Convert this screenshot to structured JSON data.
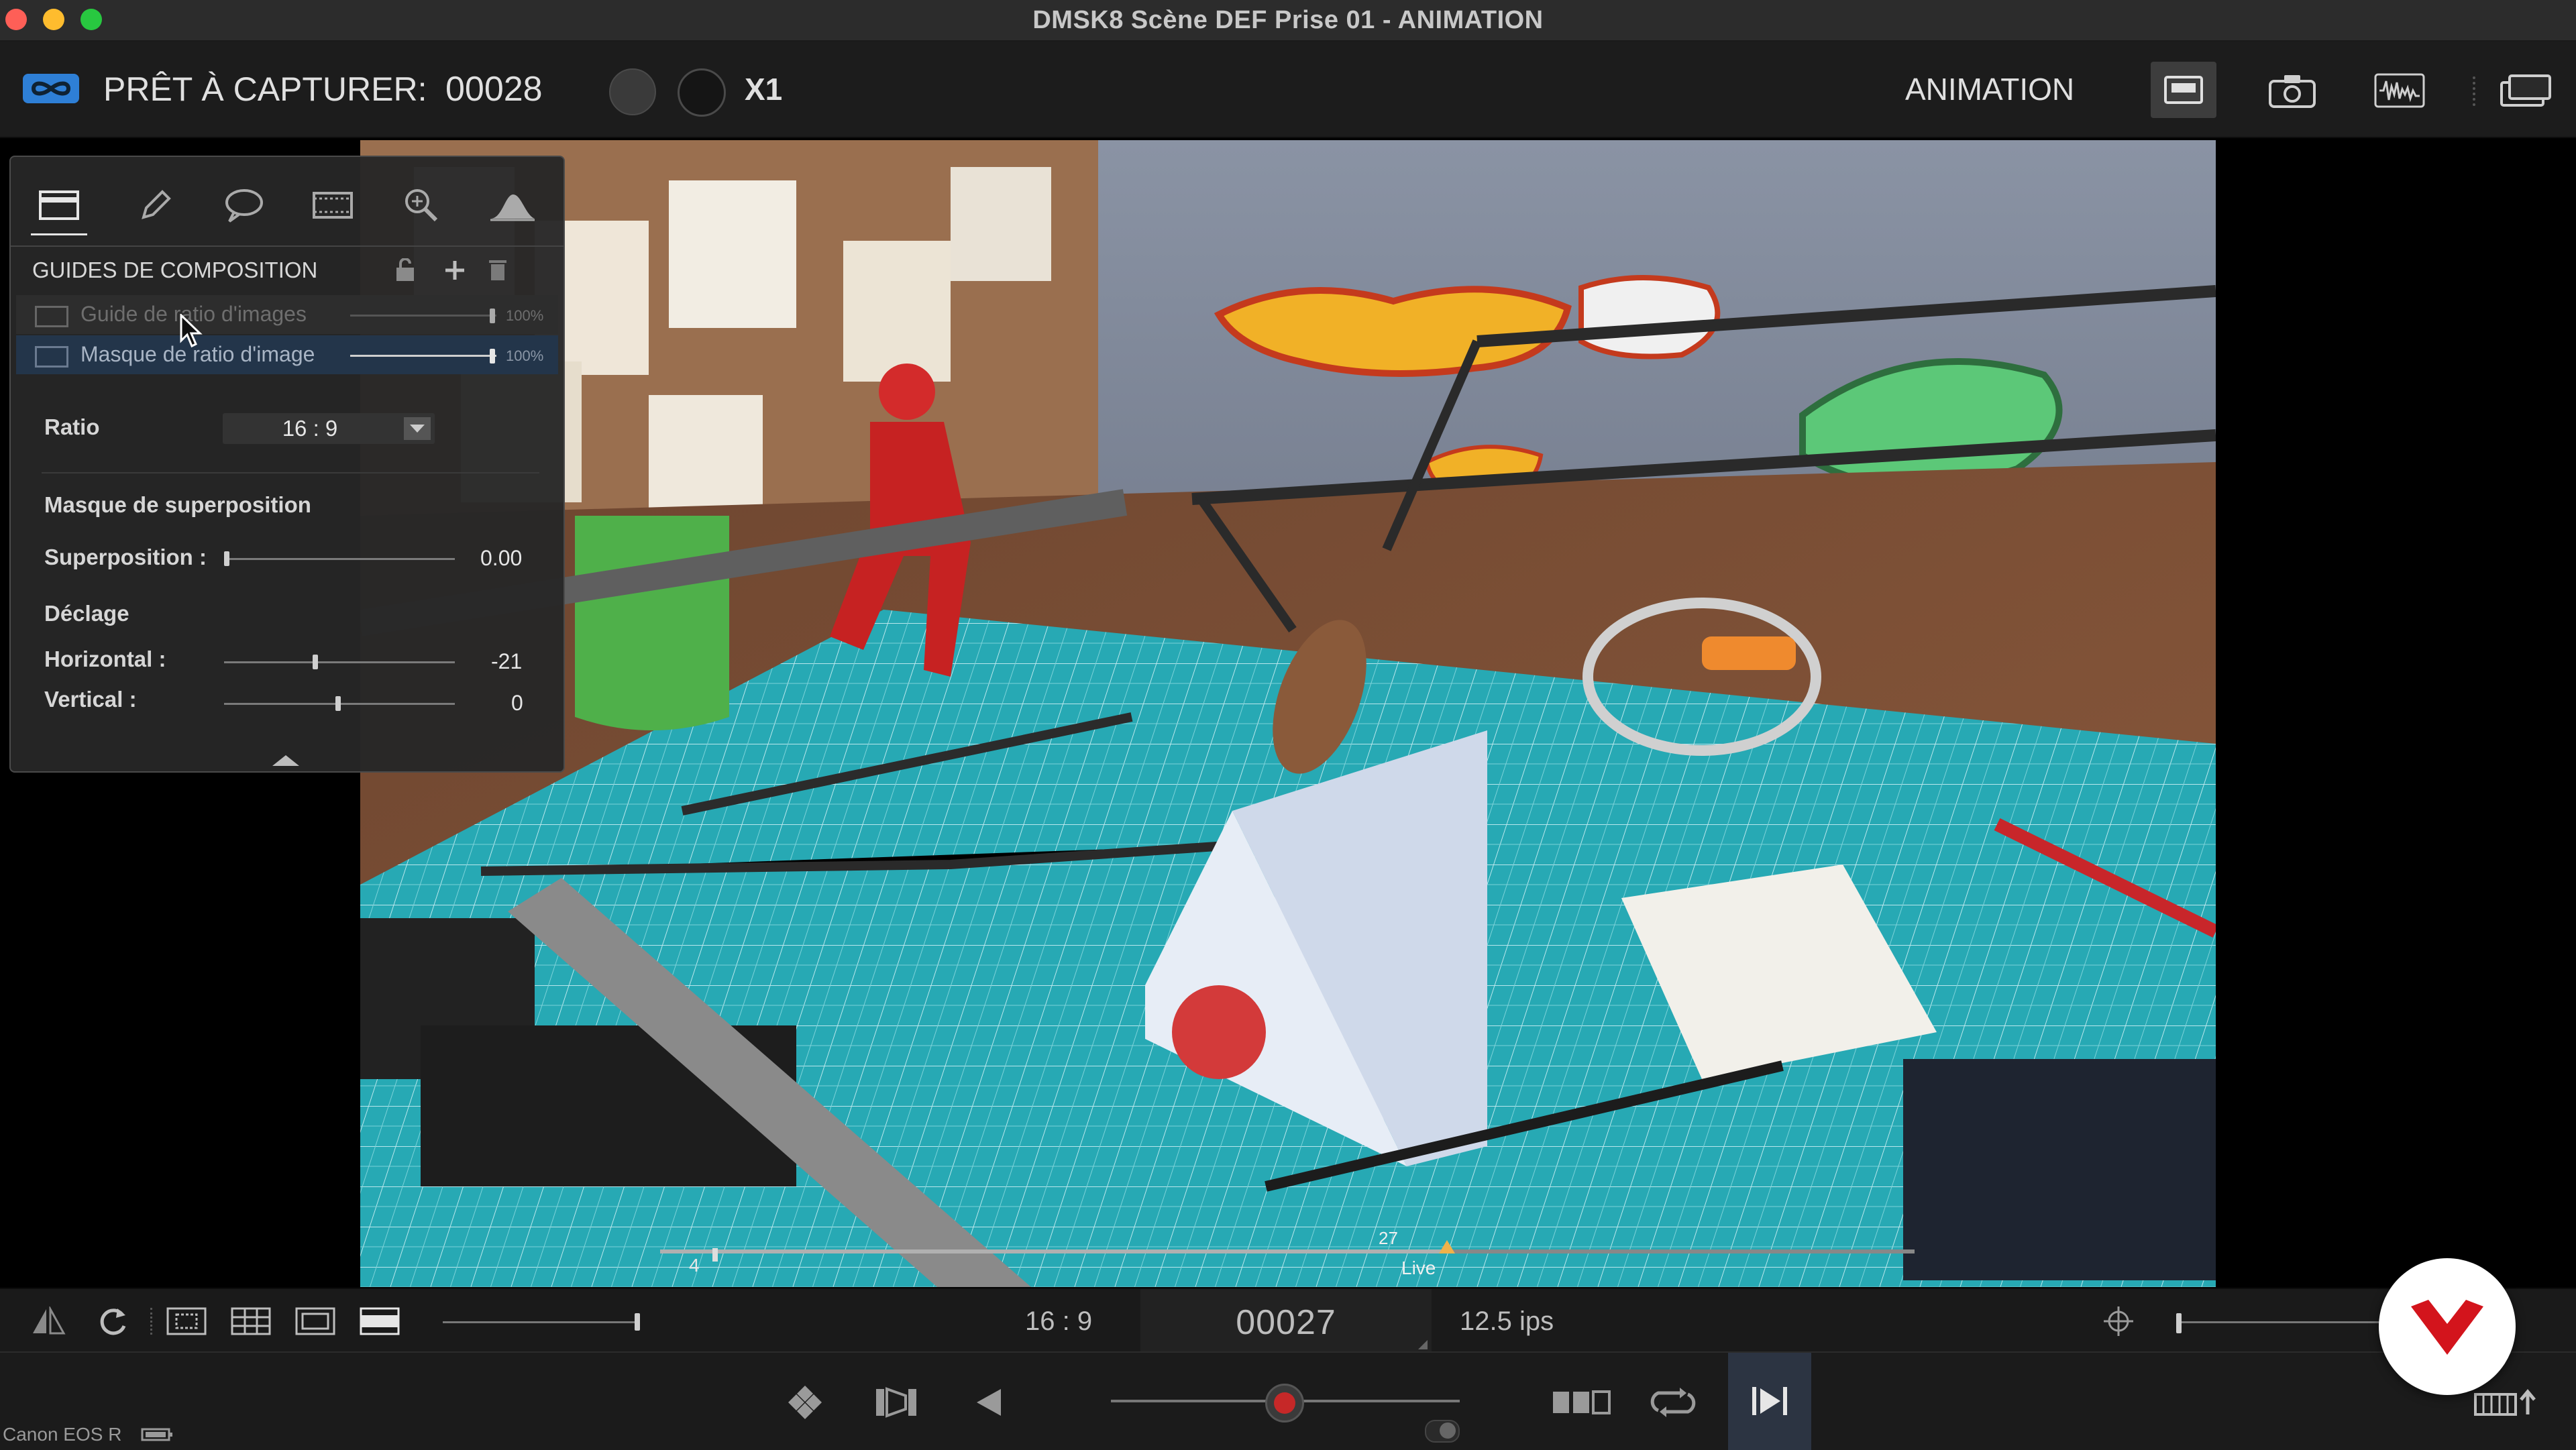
{
  "window": {
    "title": "DMSK8  Scène DEF  Prise 01 - ANIMATION"
  },
  "topbar": {
    "status_label": "PRÊT À CAPTURER:",
    "frame_counter": "00028",
    "multiplier": "X1",
    "mode_label": "ANIMATION"
  },
  "panel": {
    "section_title": "GUIDES DE COMPOSITION",
    "layers": [
      {
        "label": "Guide de ratio d'images",
        "opacity": "100%",
        "value": 1.0
      },
      {
        "label": "Masque de ratio d'image",
        "opacity": "100%",
        "value": 1.0
      }
    ],
    "ratio_label": "Ratio",
    "ratio_value": "16 : 9",
    "overlay_mask_title": "Masque de superposition",
    "overlay_label": "Superposition :",
    "overlay_value": "0.00",
    "offset_title": "Déclage",
    "horizontal_label": "Horizontal :",
    "horizontal_value": "-21",
    "vertical_label": "Vertical :",
    "vertical_value": "0"
  },
  "timeline": {
    "start_marker": "4",
    "current_marker": "27",
    "live_label": "Live"
  },
  "bottombar": {
    "aspect_label": "16 : 9",
    "current_frame": "00027",
    "frame_rate": "12.5 ips"
  },
  "statusbar": {
    "camera_name": "Canon EOS R"
  },
  "colors": {
    "accent_blue": "#2e7fd6",
    "record_red": "#c62828",
    "brand_red": "#d3141c"
  }
}
